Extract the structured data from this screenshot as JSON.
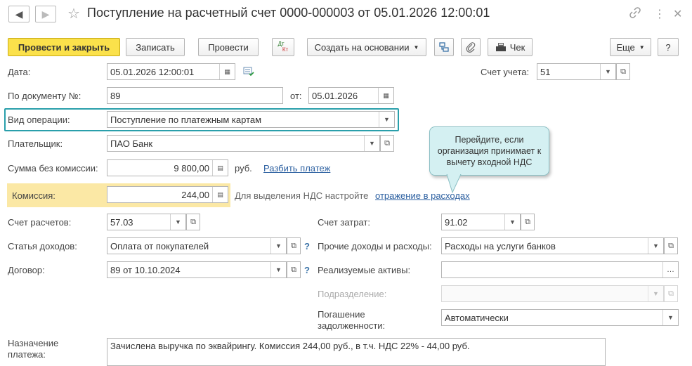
{
  "window": {
    "title": "Поступление на расчетный счет 0000-000003 от 05.01.2026 12:00:01",
    "back_icon": "🡐",
    "forward_icon": "🡒",
    "star_icon": "☆",
    "link_icon": "🔗",
    "more_icon": "⋮",
    "close_icon": "✕"
  },
  "toolbar": {
    "post_close": "Провести и закрыть",
    "save": "Записать",
    "post": "Провести",
    "dtkt_dt": "Дт",
    "dtkt_kt": "Кт",
    "create_based": "Создать на основании",
    "receipt": "Чек",
    "more": "Еще",
    "help": "?"
  },
  "form": {
    "date_label": "Дата:",
    "date_value": "05.01.2026 12:00:01",
    "account_label": "Счет учета:",
    "account_value": "51",
    "doc_label": "По документу №:",
    "doc_value": "89",
    "from_label": "от:",
    "from_value": "05.01.2026",
    "operation_label": "Вид операции:",
    "operation_value": "Поступление по платежным картам",
    "payer_label": "Плательщик:",
    "payer_value": "ПАО Банк",
    "amount_label": "Сумма без комиссии:",
    "amount_value": "9 800,00",
    "currency": "руб.",
    "split_link": "Разбить платеж",
    "commission_label": "Комиссия:",
    "commission_value": "244,00",
    "vat_hint": "Для выделения НДС настройте",
    "vat_link": "отражение в расходах",
    "settle_label": "Счет расчетов:",
    "settle_value": "57.03",
    "cost_label": "Счет затрат:",
    "cost_value": "91.02",
    "income_label": "Статья доходов:",
    "income_value": "Оплата от покупателей",
    "other_label": "Прочие доходы и расходы:",
    "other_value": "Расходы на услуги банков",
    "contract_label": "Договор:",
    "contract_value": "89 от 10.10.2024",
    "assets_label": "Реализуемые активы:",
    "assets_value": "",
    "division_label": "Подразделение:",
    "division_value": "",
    "debt_label_1": "Погашение",
    "debt_label_2": "задолженности:",
    "debt_value": "Автоматически",
    "purpose_label_1": "Назначение",
    "purpose_label_2": "платежа:",
    "purpose_value": "Зачислена выручка по эквайрингу. Комиссия 244,00 руб., в т.ч. НДС 22% - 44,00 руб.",
    "question": "?"
  },
  "tooltip": {
    "text": "Перейдите, если организация принимает к вычету входной НДС"
  },
  "colors": {
    "primary_button": "#fbe14b",
    "highlight_border": "#2a9fab",
    "commission_highlight": "#fbe8a5",
    "tooltip_bg": "#d4f0f2",
    "link": "#2b5fa0"
  }
}
